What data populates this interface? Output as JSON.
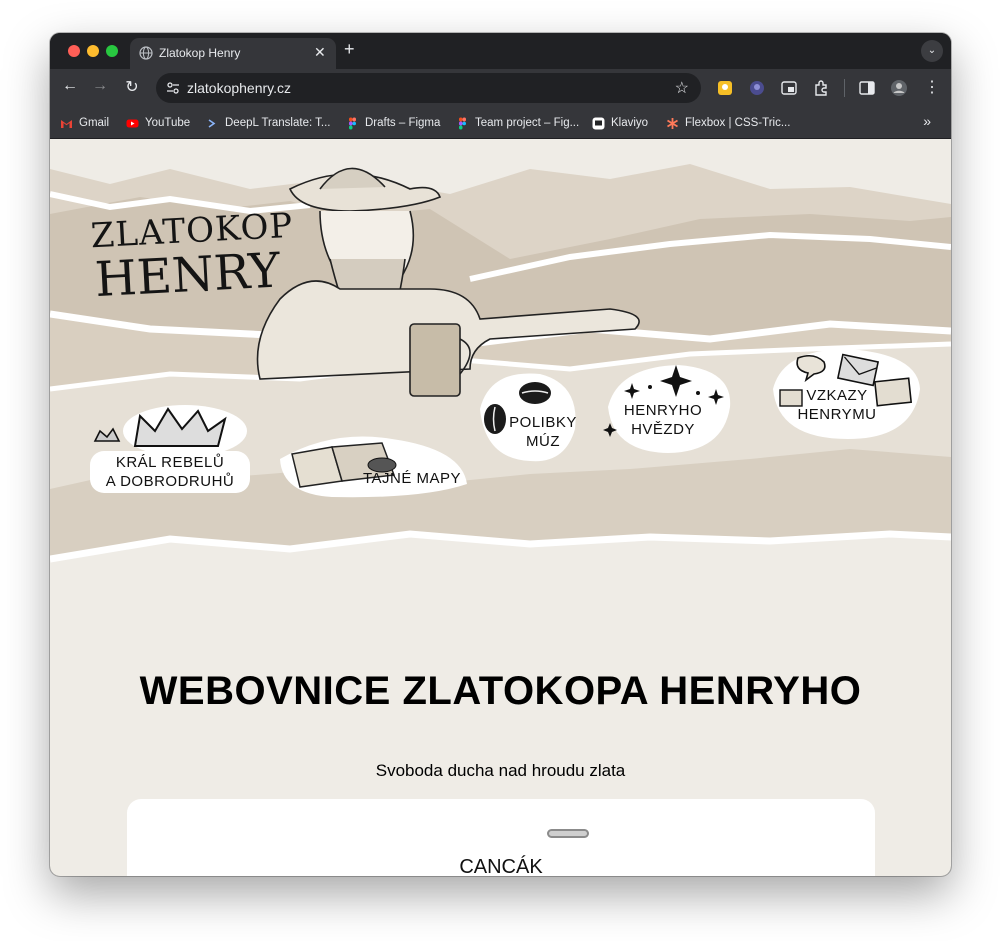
{
  "browser": {
    "tab_title": "Zlatokop Henry",
    "url": "zlatokophenry.cz",
    "bookmarks": [
      {
        "label": "Gmail",
        "icon": "gmail-icon"
      },
      {
        "label": "YouTube",
        "icon": "youtube-icon"
      },
      {
        "label": "DeepL Translate: T...",
        "icon": "deepl-icon"
      },
      {
        "label": "Drafts – Figma",
        "icon": "figma-icon"
      },
      {
        "label": "Team project – Fig...",
        "icon": "figma-icon"
      },
      {
        "label": "Klaviyo",
        "icon": "klaviyo-icon"
      },
      {
        "label": "Flexbox | CSS-Tric...",
        "icon": "css-tricks-icon"
      }
    ]
  },
  "site": {
    "logo_line1": "ZLATOKOP",
    "logo_line2": "HENRY",
    "nav": [
      {
        "line1": "KRÁL REBELŮ",
        "line2": "A DOBRODRUHŮ",
        "icon": "crown-icon"
      },
      {
        "line1": "TAJNÉ MAPY",
        "line2": "",
        "icon": "map-icon"
      },
      {
        "line1": "POLIBKY",
        "line2": "MÚZ",
        "icon": "kiss-lips-icon"
      },
      {
        "line1": "HENRYHO",
        "line2": "HVĚZDY",
        "icon": "stars-icon"
      },
      {
        "line1": "VZKAZY",
        "line2": "HENRYMU",
        "icon": "letters-icon"
      }
    ],
    "title": "WEBOVNICE ZLATOKOPA HENRYHO",
    "tagline": "Svoboda ducha nad hroudu zlata",
    "card_title": "CANCÁK"
  },
  "colors": {
    "page_bg": "#efece6",
    "paper_dark": "#cfc5b6",
    "chrome_dark": "#202124",
    "chrome_mid": "#35363a"
  }
}
